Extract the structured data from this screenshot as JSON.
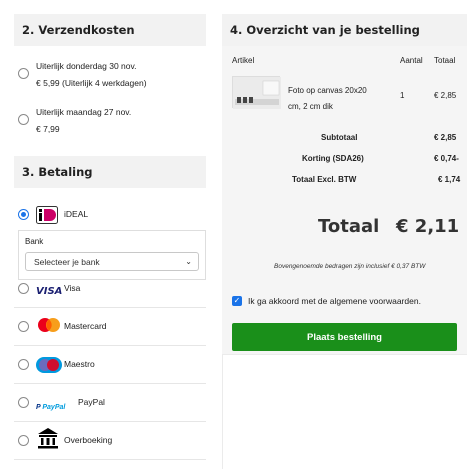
{
  "shipping": {
    "title": "2. Verzendkosten",
    "options": [
      {
        "line1": "Uiterlijk donderdag 30 nov.",
        "line2": "€ 5,99 (Uiterlijk 4 werkdagen)",
        "selected": false
      },
      {
        "line1": "Uiterlijk maandag 27 nov.",
        "line2": "€ 7,99",
        "selected": false
      }
    ]
  },
  "payment": {
    "title": "3. Betaling",
    "methods": [
      {
        "label": "iDEAL",
        "selected": true,
        "logo_text": "iDEAL"
      },
      {
        "label": "Visa",
        "selected": false,
        "logo_text": "VISA"
      },
      {
        "label": "Mastercard",
        "selected": false,
        "logo_text": "mastercard"
      },
      {
        "label": "Maestro",
        "selected": false,
        "logo_text": "Maestro"
      },
      {
        "label": "PayPal",
        "selected": false,
        "logo_text": "PayPal"
      },
      {
        "label": "Overboeking",
        "selected": false
      }
    ],
    "bank": {
      "label": "Bank",
      "selected": "Selecteer je bank"
    }
  },
  "summary": {
    "title": "4. Overzicht van je bestelling",
    "headers": {
      "article": "Artikel",
      "qty": "Aantal",
      "total": "Totaal"
    },
    "item": {
      "name_line1": "Foto op canvas 20x20",
      "name_line2": "cm, 2 cm dik",
      "qty": "1",
      "total": "€ 2,85"
    },
    "subtotal_label": "Subtotaal",
    "subtotal_value": "€ 2,85",
    "discount_label": "Korting (SDA26)",
    "discount_value": "€ 0,74-",
    "excl_label": "Totaal Excl. BTW",
    "excl_value": "€ 1,74",
    "total_label": "Totaal",
    "total_value": "€ 2,11",
    "vat_note": "Bovengenoemde bedragen zijn inclusief € 0,37 BTW",
    "agree_text": "Ik ga akkoord met de algemene voorwaarden.",
    "agree_checked": true,
    "order_button": "Plaats bestelling"
  },
  "colors": {
    "accent": "#1a73e8",
    "order_button": "#1a8f1a",
    "panel_bg": "#f5f5f5"
  }
}
